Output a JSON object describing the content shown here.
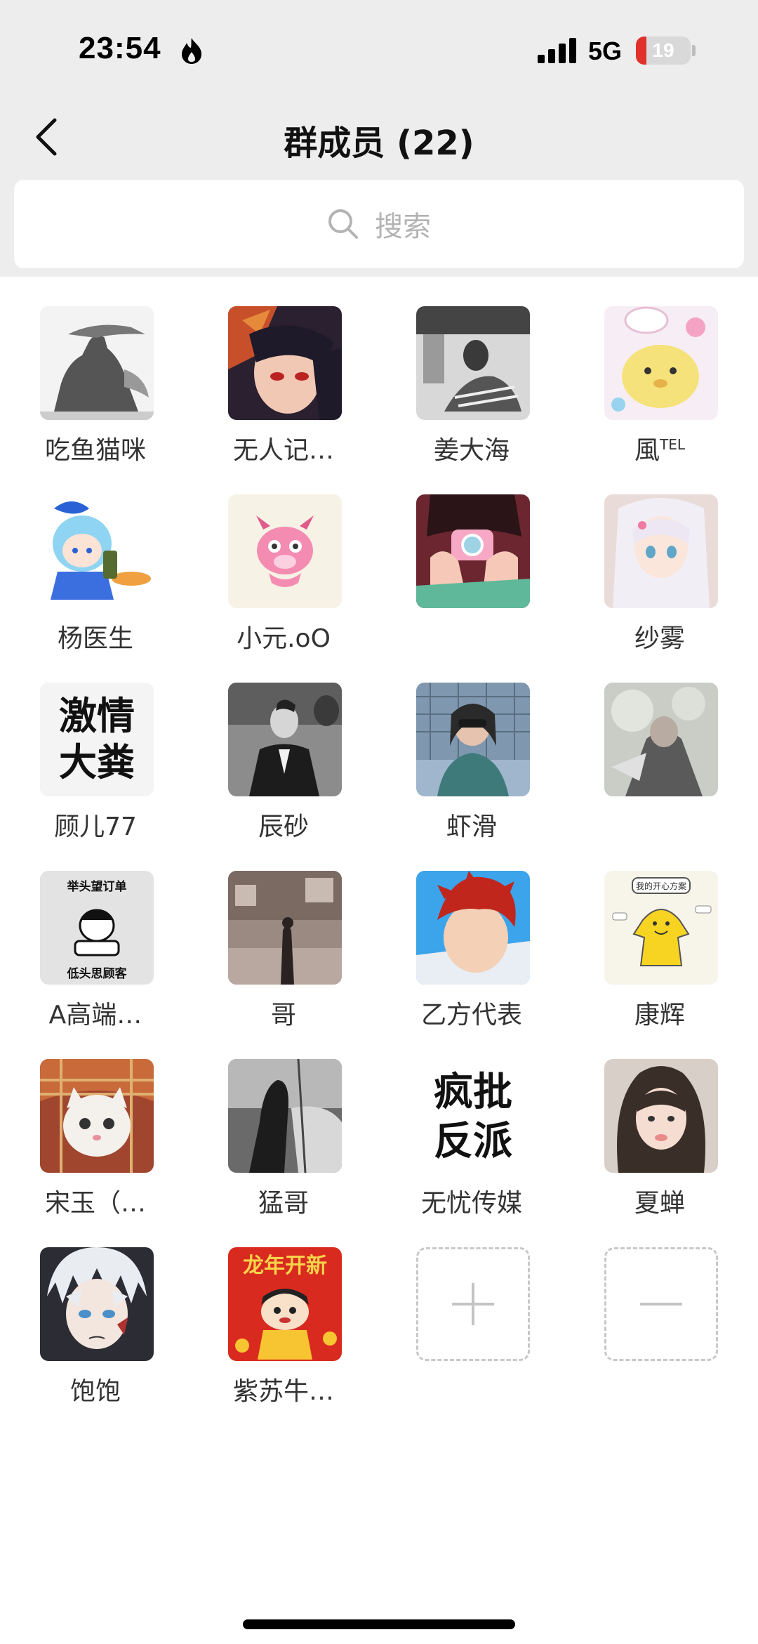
{
  "status_bar": {
    "time": "23:54",
    "network": "5G",
    "battery_level": "19",
    "battery_fraction": 0.19
  },
  "header": {
    "title": "群成员 (22)",
    "back_icon": "chevron-left-icon"
  },
  "search": {
    "placeholder": "搜索",
    "icon": "search-icon"
  },
  "members": [
    {
      "name": "吃鱼猫咪"
    },
    {
      "name": "无人记…"
    },
    {
      "name": "姜大海"
    },
    {
      "name": "風",
      "suffix": "TEL"
    },
    {
      "name": "杨医生"
    },
    {
      "name": "小元.oO"
    },
    {
      "name": ""
    },
    {
      "name": "纱雾"
    },
    {
      "name": "顾儿77",
      "avatar_text": [
        "激情",
        "大粪"
      ]
    },
    {
      "name": "辰砂"
    },
    {
      "name": "虾滑"
    },
    {
      "name": ""
    },
    {
      "name": "A高端…",
      "avatar_text": [
        "举头望订单",
        "低头思顾客"
      ]
    },
    {
      "name": "哥"
    },
    {
      "name": "乙方代表"
    },
    {
      "name": "康辉",
      "avatar_text": [
        "我的开心方案"
      ]
    },
    {
      "name": "宋玉（…"
    },
    {
      "name": "猛哥"
    },
    {
      "name": "无忧传媒",
      "avatar_text": [
        "疯批",
        "反派"
      ]
    },
    {
      "name": "夏蝉"
    },
    {
      "name": "饱饱"
    },
    {
      "name": "紫苏牛…",
      "avatar_text": [
        "龙年开新"
      ]
    }
  ],
  "actions": {
    "add_icon": "plus-icon",
    "remove_icon": "minus-icon"
  },
  "colors": {
    "header_bg": "#ededed",
    "battery_low": "#e0312b",
    "text_primary": "#111111",
    "placeholder": "#b3b3b3"
  }
}
